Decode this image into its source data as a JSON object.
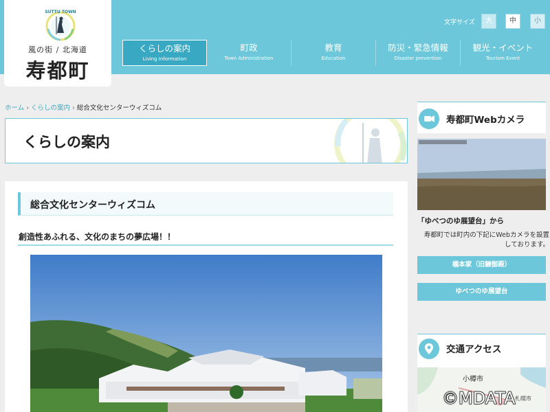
{
  "header": {
    "logo": {
      "arc_text": "SUTTU TOWN",
      "tagline": "風の街 / 北海道",
      "name": "寿都町"
    },
    "font_size": {
      "label": "文字サイズ",
      "large": "大",
      "medium": "中",
      "small": "小"
    },
    "nav": [
      {
        "jp": "くらしの案内",
        "en": "Living Information"
      },
      {
        "jp": "町政",
        "en": "Town Administration"
      },
      {
        "jp": "教育",
        "en": "Education"
      },
      {
        "jp": "防災・緊急情報",
        "en": "Disaster prevention"
      },
      {
        "jp": "観光・イベント",
        "en": "Tourism Event"
      }
    ]
  },
  "breadcrumb": {
    "home": "ホーム",
    "sep1": "›",
    "section": "くらしの案内",
    "sep2": "›",
    "current": "総合文化センターウィズコム"
  },
  "page_title": "くらしの案内",
  "content": {
    "heading": "総合文化センターウィズコム",
    "lead": "創造性あふれる、文化のまちの夢広場！！"
  },
  "sidebar": {
    "webcam": {
      "title": "寿都町Webカメラ",
      "caption": "「ゆべつのゆ展望台」から",
      "desc_line1": "寿都町では町内の下記にWebカメラを設置",
      "desc_line2": "しております。",
      "buttons": [
        "橋本家（旧鰊御殿）",
        "ゆべつのゆ展望台"
      ]
    },
    "access": {
      "title": "交通アクセス",
      "map_city": "小樽市",
      "map_city2": "札幌市"
    }
  },
  "watermark": "©MDATA",
  "colors": {
    "header_bg": "#6cc7da",
    "nav_active_bg": "#39a9c3",
    "link": "#3fa9c2",
    "page_bg": "#eeeeee"
  }
}
